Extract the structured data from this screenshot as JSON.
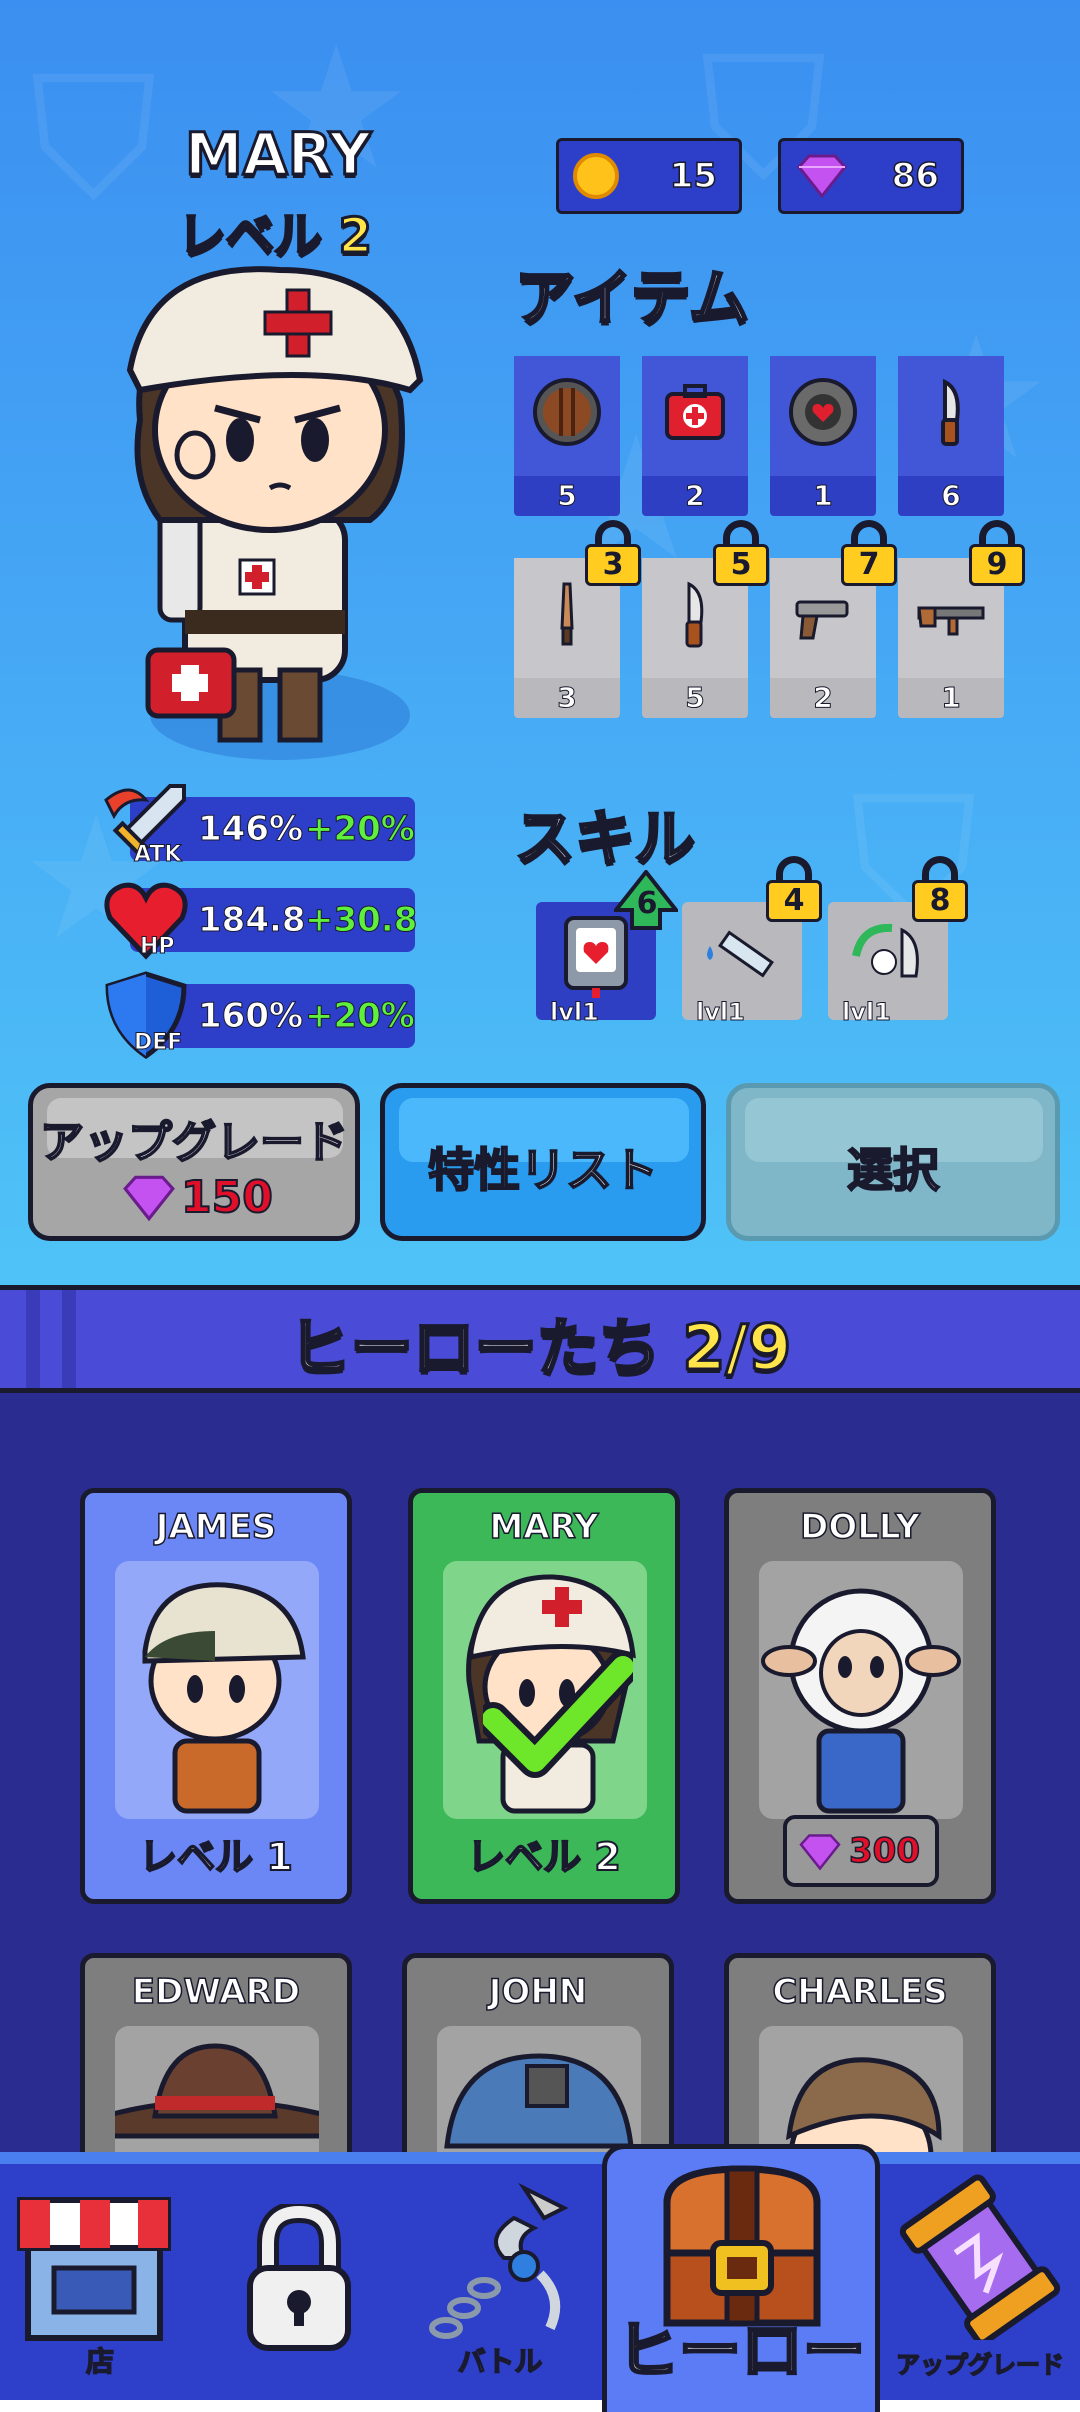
{
  "hero": {
    "name": "MARY",
    "level_label": "レベル 2"
  },
  "currencies": {
    "coins": "15",
    "gems": "86"
  },
  "items_title": "アイテム",
  "items": [
    {
      "icon": "shield-icon",
      "count": "5"
    },
    {
      "icon": "medkit-icon",
      "count": "2"
    },
    {
      "icon": "heart-shield-icon",
      "count": "1"
    },
    {
      "icon": "knife-icon",
      "count": "6"
    }
  ],
  "locked_items": [
    {
      "icon": "bat-icon",
      "count": "3",
      "unlock_level": "3"
    },
    {
      "icon": "knife-icon",
      "count": "5",
      "unlock_level": "5"
    },
    {
      "icon": "pistol-icon",
      "count": "2",
      "unlock_level": "7"
    },
    {
      "icon": "rifle-icon",
      "count": "1",
      "unlock_level": "9"
    }
  ],
  "stats": {
    "atk": {
      "label": "ATK",
      "value": "146%",
      "bonus": "+20%"
    },
    "hp": {
      "label": "HP",
      "value": "184.8",
      "bonus": "+30.8"
    },
    "def": {
      "label": "DEF",
      "value": "160%",
      "bonus": "+20%"
    }
  },
  "skills_title": "スキル",
  "skills": [
    {
      "icon": "heart-card-icon",
      "level": "lvl1",
      "badge": "6"
    },
    {
      "icon": "syringe-icon",
      "level": "lvl1",
      "badge": "4"
    },
    {
      "icon": "heal-knife-icon",
      "level": "lvl1",
      "badge": "8"
    }
  ],
  "buttons": {
    "upgrade_label": "アップグレード",
    "upgrade_cost": "150",
    "traits_label": "特性リスト",
    "select_label": "選択"
  },
  "heroes_section": {
    "title": "ヒーローたち",
    "count": "2/9"
  },
  "hero_cards": [
    {
      "name": "JAMES",
      "level_label": "レベル 1"
    },
    {
      "name": "MARY",
      "level_label": "レベル 2"
    },
    {
      "name": "DOLLY",
      "price": "300"
    },
    {
      "name": "EDWARD"
    },
    {
      "name": "JOHN"
    },
    {
      "name": "CHARLES"
    }
  ],
  "nav": {
    "shop": "店",
    "battle": "バトル",
    "heroes": "ヒーロー",
    "upgrade": "アップグレード"
  },
  "colors": {
    "accent_blue": "#2d3fc9",
    "selected_green": "#3cb858",
    "gold": "#ffe54a",
    "bonus_green": "#5ef03c",
    "price_red": "#e0102a"
  }
}
